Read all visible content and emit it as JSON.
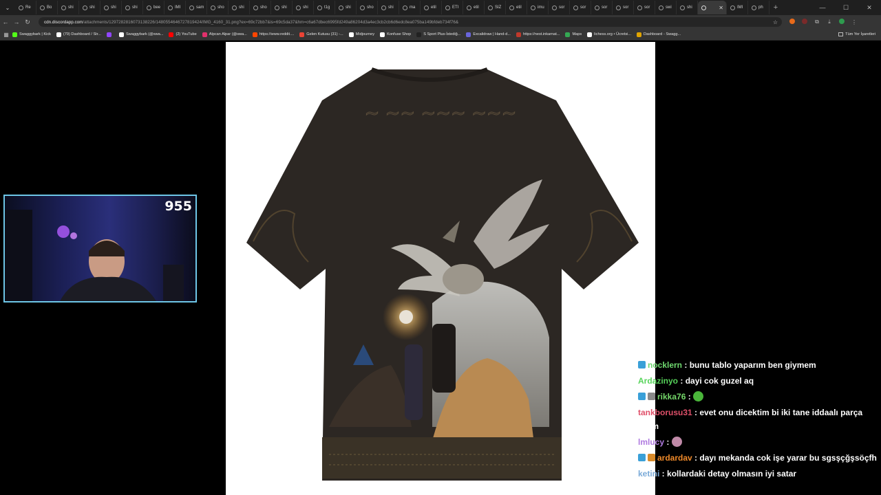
{
  "browser": {
    "tab_labels": [
      "Re",
      "Bo",
      "shi",
      "shi",
      "shi",
      "shi",
      "bee",
      "IMI",
      "sam",
      "sho",
      "shi",
      "sho",
      "shi",
      "shi",
      "t1g",
      "shi",
      "sho",
      "shi",
      "ma",
      "etil",
      "ETI",
      "etil",
      "SIZ",
      "etil",
      "imu",
      "sor",
      "sor",
      "sor",
      "sor",
      "sor",
      "swi",
      "shi"
    ],
    "active_tab_label": "",
    "tabs_after": [
      "IMI",
      "ph"
    ],
    "url_host": "cdn.discordapp.com",
    "url_path": "/attachments/1297282816073138226/1480554646727819424/IMG_4160_31.png?ex=69c72bb7&is=69c5da37&hm=c6a67dbec6995fd249a86204d3a4ec3cb2cb6d6edc8ea075ba149bfdeb734f76&",
    "bookmarks": [
      {
        "label": "Swaggybark | Kick",
        "color": "#53fc18"
      },
      {
        "label": "(79) Dashboard / Str...",
        "color": "#ffffff"
      },
      {
        "label": "",
        "color": "#9146ff"
      },
      {
        "label": "Swaggybark (@swa...",
        "color": "#ffffff"
      },
      {
        "label": "(2) YouTube",
        "color": "#ff0000"
      },
      {
        "label": "Alpcan Alpar (@swa...",
        "color": "#e1306c"
      },
      {
        "label": "https://www.reddit....",
        "color": "#ff4500"
      },
      {
        "label": "Gelen Kutusu (31) -...",
        "color": "#ea4335"
      },
      {
        "label": "Midjourney",
        "color": "#ffffff"
      },
      {
        "label": "Konfuse Shop",
        "color": "#ffffff"
      },
      {
        "label": "S Sport Plus-İstediğ...",
        "color": "#222222"
      },
      {
        "label": "Excalidraw | Hand-d...",
        "color": "#6965db"
      },
      {
        "label": "https://nest.inkarnat...",
        "color": "#c0392b"
      },
      {
        "label": "Maps",
        "color": "#34a853"
      },
      {
        "label": "lichess.org • Ücretsi...",
        "color": "#ffffff"
      },
      {
        "label": "Dashboard - Swagg...",
        "color": "#e0a400"
      }
    ],
    "all_bookmarks_label": "Tüm Yer İşaretleri"
  },
  "webcam": {
    "viewer_count": "955"
  },
  "chat": [
    {
      "user": "nocklern",
      "user_color": "#6fd96f",
      "badges": [
        "#3aa0d8"
      ],
      "message": "bunu tablo yaparım ben giymem",
      "emote": ""
    },
    {
      "user": "Ardazinyo",
      "user_color": "#57d45b",
      "badges": [],
      "message": "dayi cok guzel aq",
      "emote": ""
    },
    {
      "user": "rikka76",
      "user_color": "#75d96a",
      "badges": [
        "#3aa0d8",
        "#8a8a8a"
      ],
      "message": "",
      "emote": "#4ab53a"
    },
    {
      "user": "tankborusu31",
      "user_color": "#e0506a",
      "badges": [],
      "message": "evet onu dicektim bi iki tane iddaalı parça lazım",
      "emote": ""
    },
    {
      "user": "lmlucy",
      "user_color": "#b07be0",
      "badges": [],
      "message": "",
      "emote": "#c08aa8"
    },
    {
      "user": "ardardav",
      "user_color": "#f08a2a",
      "badges": [
        "#3aa0d8",
        "#d88a2a"
      ],
      "message": "dayı mekanda cok işe yarar bu sgsşçğşsöçfh",
      "emote": ""
    },
    {
      "user": "ketini",
      "user_color": "#7aaad8",
      "badges": [],
      "message": "kollardaki detay olmasın iyi satar",
      "emote": ""
    }
  ]
}
